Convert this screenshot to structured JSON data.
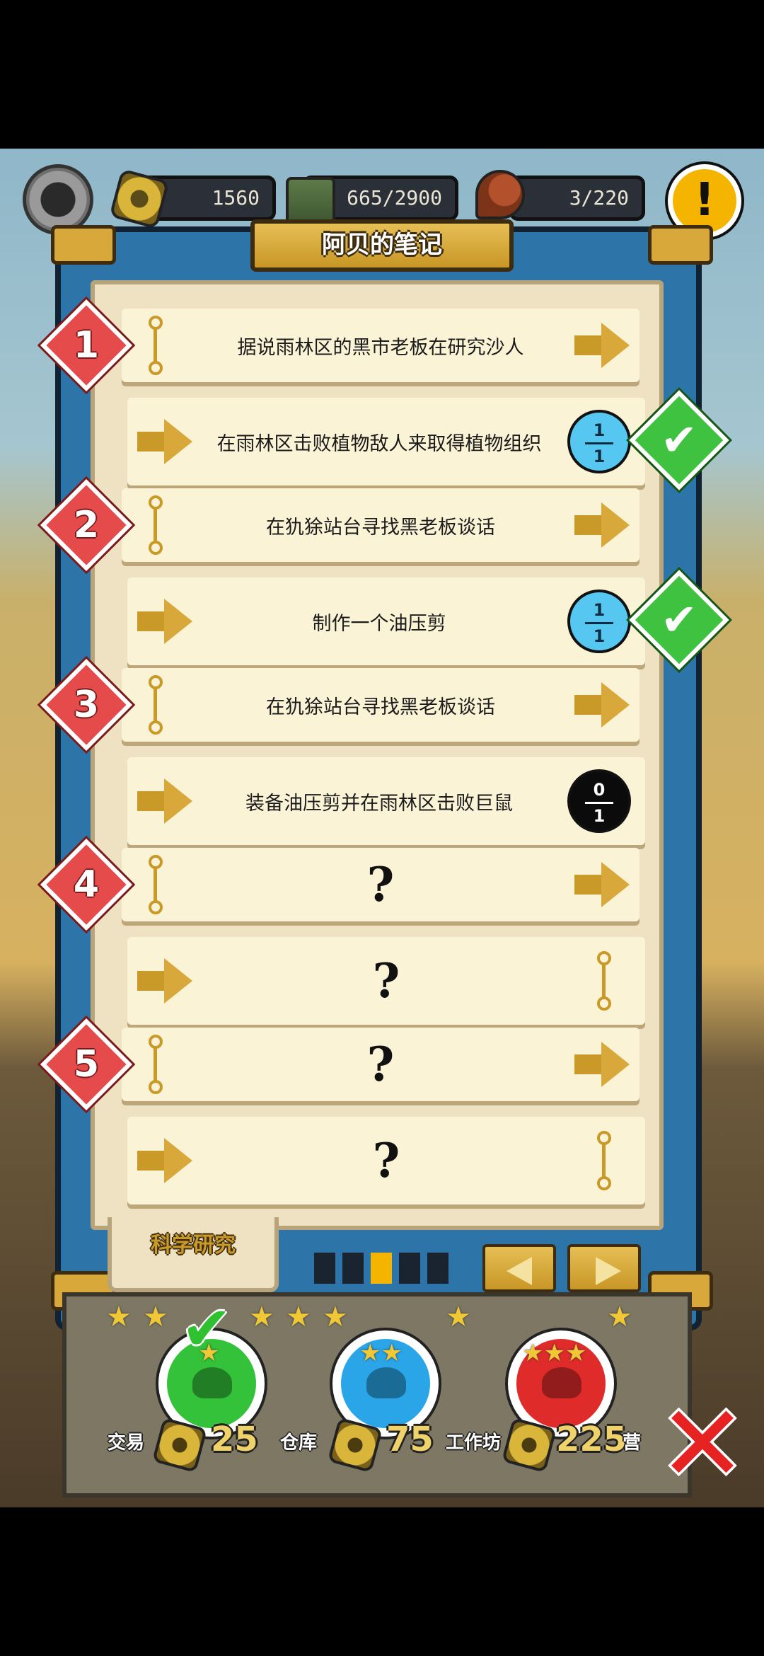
{
  "hud": {
    "coins": "1560",
    "storage": "665/2900",
    "food": "3/220",
    "alert_label": "!"
  },
  "panel": {
    "title": "阿贝的笔记",
    "tab_label": "科学研究",
    "page_indicator": {
      "total": 5,
      "current": 3
    }
  },
  "chapters": [
    {
      "number": "1",
      "title": "据说雨林区的黑市老板在研究沙人",
      "task": "在雨林区击败植物敌人来取得植物组织",
      "progress_num": "1",
      "progress_den": "1",
      "completed": true
    },
    {
      "number": "2",
      "title": "在犰狳站台寻找黑老板谈话",
      "task": "制作一个油压剪",
      "progress_num": "1",
      "progress_den": "1",
      "completed": true
    },
    {
      "number": "3",
      "title": "在犰狳站台寻找黑老板谈话",
      "task": "装备油压剪并在雨林区击败巨鼠",
      "progress_num": "0",
      "progress_den": "1",
      "completed": false
    },
    {
      "number": "4",
      "title": "?",
      "task": "?"
    },
    {
      "number": "5",
      "title": "?",
      "task": "?"
    }
  ],
  "difficulty": [
    {
      "label": "交易",
      "cost": "25",
      "stars": 1,
      "color": "#34c23a",
      "completed": true
    },
    {
      "label": "仓库",
      "cost": "75",
      "stars": 2,
      "color": "#2aa5e8",
      "completed": false
    },
    {
      "label": "工作坊",
      "cost": "225",
      "stars": 3,
      "color": "#e02b2b",
      "completed": false
    }
  ],
  "base_extra_label": "营",
  "close_label": "✕",
  "colors": {
    "frame": "#2d74a8",
    "gold": "#d8a93a",
    "paper": "#eee2c2",
    "diamond": "#e64b4b",
    "check": "#3fc23f"
  }
}
